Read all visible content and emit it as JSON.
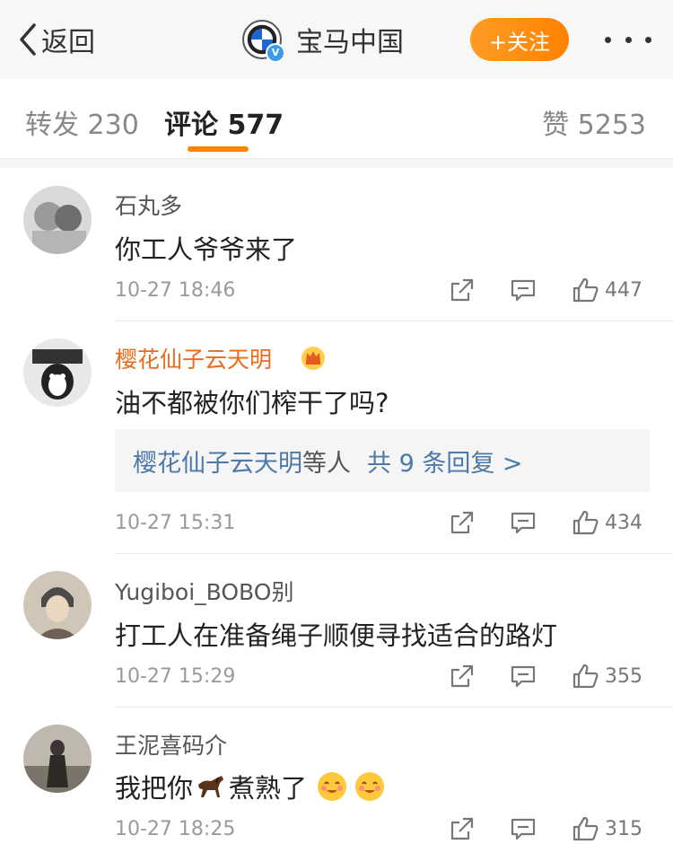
{
  "header": {
    "back_label": "返回",
    "account_name": "宝马中国",
    "follow_label": "+关注",
    "icons": {
      "back": "chevron-left-icon",
      "more": "more-dots-icon",
      "verified": "verified-badge-icon"
    },
    "colors": {
      "follow_bg": "#ff8200",
      "verified": "#3a9ce8"
    }
  },
  "tabs": {
    "repost_label": "转发 230",
    "comments_label": "评论 577",
    "likes_label": "赞 5253",
    "active": "comments",
    "accent": "#ff8200"
  },
  "comments": [
    {
      "username": "石丸多",
      "text": "你工人爷爷来了",
      "time": "10-27 18:46",
      "likes": "447"
    },
    {
      "username": "樱花仙子云天明",
      "vip_icon": "crown-icon",
      "text": "油不都被你们榨干了吗?",
      "time": "10-27 15:31",
      "likes": "434",
      "replies": {
        "users": "樱花仙子云天明",
        "suffix": "等人",
        "count": "共 9 条回复 >"
      }
    },
    {
      "username": "Yugiboi_BOBO别",
      "text": "打工人在准备绳子顺便寻找适合的路灯",
      "time": "10-27 15:29",
      "likes": "355"
    },
    {
      "username": "王泥喜码介",
      "text_before": "我把你",
      "text_after": "煮熟了",
      "inline_icons": [
        "horse-emoji-icon",
        "blush-emoji-icon",
        "blush-emoji-icon"
      ],
      "time": "10-27 18:25",
      "likes": "315"
    }
  ],
  "action_icons": [
    "share-icon",
    "comment-icon",
    "like-icon"
  ]
}
